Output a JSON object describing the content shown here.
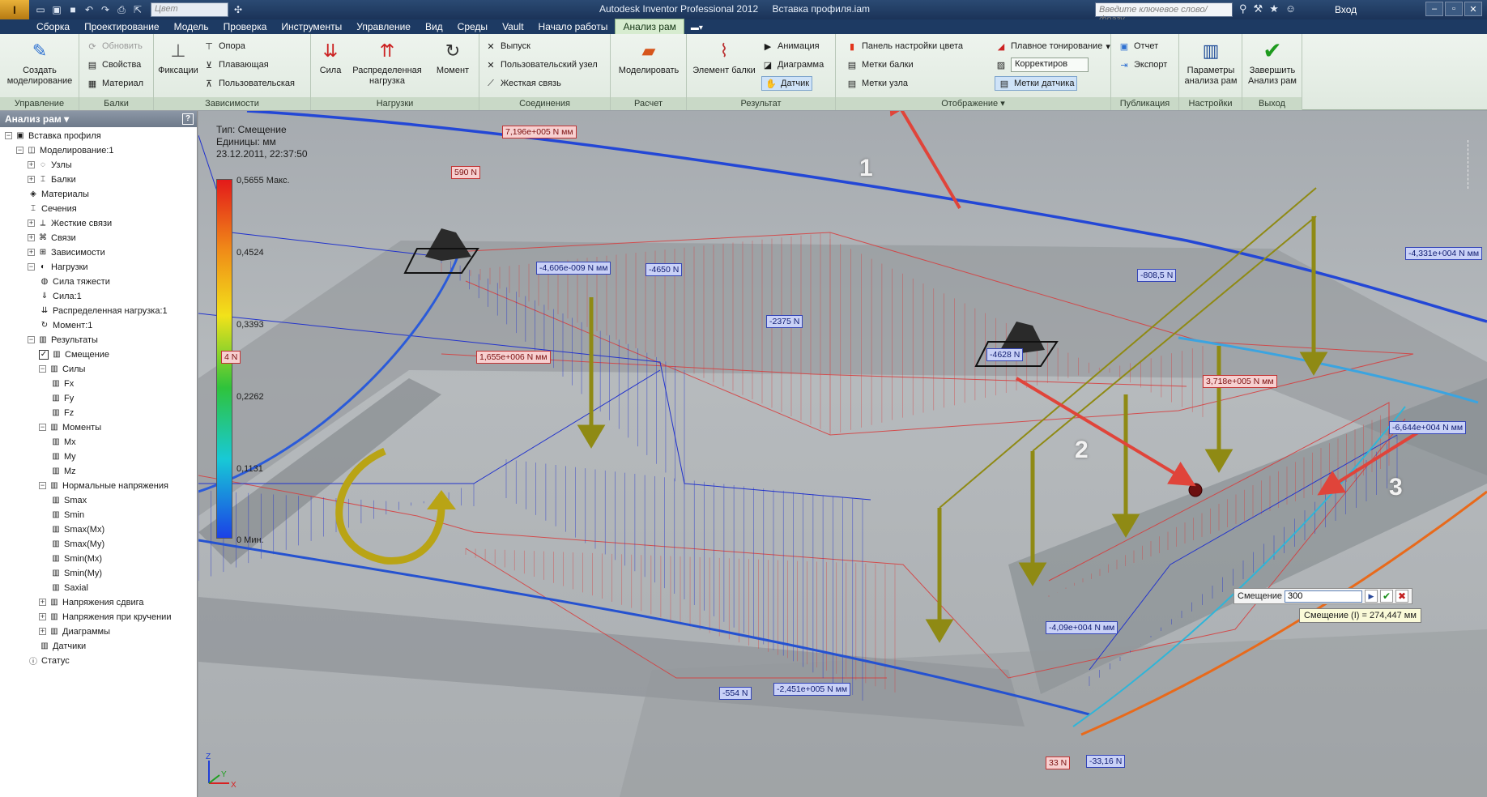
{
  "titlebar": {
    "app_letter": "I",
    "color_select": "Цвет",
    "app_title": "Autodesk Inventor Professional 2012",
    "doc_title": "Вставка профиля.iam",
    "search_placeholder": "Введите ключевое слово/фразу",
    "login": "Вход"
  },
  "tabs": [
    "Сборка",
    "Проектирование",
    "Модель",
    "Проверка",
    "Инструменты",
    "Управление",
    "Вид",
    "Среды",
    "Vault",
    "Начало работы",
    "Анализ рам"
  ],
  "ribbon": {
    "manage": {
      "title": "Управление",
      "create": "Создать моделирование"
    },
    "beams": {
      "title": "Балки",
      "update": "Обновить",
      "props": "Свойства",
      "material": "Материал"
    },
    "constraints": {
      "title": "Зависимости",
      "fix": "Фиксации",
      "pin": "Опора",
      "float": "Плавающая",
      "custom": "Пользовательская"
    },
    "loads": {
      "title": "Нагрузки",
      "force": "Сила",
      "dist": "Распределенная нагрузка",
      "moment": "Момент"
    },
    "connections": {
      "title": "Соединения",
      "release": "Выпуск",
      "custom_node": "Пользовательский узел",
      "rigid": "Жесткая связь"
    },
    "calc": {
      "title": "Расчет",
      "simulate": "Моделировать"
    },
    "result": {
      "title": "Результат",
      "beam_elem": "Элемент балки",
      "anim": "Анимация",
      "diagram": "Диаграмма",
      "sensor": "Датчик"
    },
    "display": {
      "title": "Отображение",
      "color_panel": "Панель настройки цвета",
      "beam_labels": "Метки балки",
      "node_labels": "Метки узла",
      "smooth": "Плавное тонирование",
      "correctors": "Корректиров",
      "sensor_labels": "Метки датчика"
    },
    "publish": {
      "title": "Публикация",
      "report": "Отчет",
      "export": "Экспорт"
    },
    "settings": {
      "title": "Настройки",
      "params": "Параметры анализа рам"
    },
    "exit": {
      "title": "Выход",
      "finish": "Завершить Анализ рам"
    }
  },
  "browser": {
    "title": "Анализ рам",
    "nodes": [
      "Вставка профиля",
      "Моделирование:1",
      "Узлы",
      "Балки",
      "Материалы",
      "Сечения",
      "Жесткие связи",
      "Связи",
      "Зависимости",
      "Нагрузки",
      "Сила тяжести",
      "Сила:1",
      "Распределенная нагрузка:1",
      "Момент:1",
      "Результаты",
      "Смещение",
      "Силы",
      "Fx",
      "Fy",
      "Fz",
      "Моменты",
      "Mx",
      "My",
      "Mz",
      "Нормальные напряжения",
      "Smax",
      "Smin",
      "Smax(Mx)",
      "Smax(My)",
      "Smin(Mx)",
      "Smin(My)",
      "Saxial",
      "Напряжения сдвига",
      "Напряжения при кручении",
      "Диаграммы",
      "Датчики",
      "Статус"
    ]
  },
  "viewport": {
    "info_type": "Тип: Смещение",
    "info_units": "Единицы: мм",
    "info_date": "23.12.2011, 22:37:50",
    "legend": [
      "0,5655 Макс.",
      "0,4524",
      "0,3393",
      "0,2262",
      "0,1131",
      "0 Мин."
    ],
    "legend_partial": "4 N",
    "labels": {
      "r1": "7,196e+005 N мм",
      "r2": "590 N",
      "r3": "1,655e+006 N мм",
      "r4": "3,718e+005 N мм",
      "r5": "33 N",
      "b1": "-4,606e-009 N мм",
      "b2": "-4650 N",
      "b3": "-2375 N",
      "b4": "-4628 N",
      "b5": "-808,5 N",
      "b6": "-4,331e+004 N мм",
      "b7": "-6,644e+004 N мм",
      "b8": "-4,09e+004 N мм",
      "b9": "-554 N",
      "b10": "-2,451e+005 N мм",
      "b11": "-33,16 N"
    },
    "steps": [
      "1",
      "2",
      "3"
    ],
    "sensor": {
      "label": "Смещение",
      "value": "300",
      "tooltip": "Смещение (I) = 274,447 мм"
    },
    "axes": {
      "z": "Z",
      "y": "Y",
      "x": "X"
    }
  },
  "colors": {
    "ribbon_active": "#d7ecd0",
    "title_bar": "#1d3a63",
    "diagram_red": "#d33",
    "diagram_blue": "#2233cc",
    "arrow_red": "#e0443a",
    "force_arrow": "#8f8a14"
  }
}
